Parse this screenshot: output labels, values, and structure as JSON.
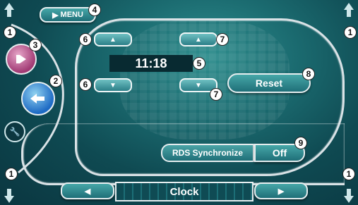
{
  "menu": {
    "label": "MENU"
  },
  "clock": {
    "time": "11:18"
  },
  "buttons": {
    "reset": "Reset",
    "rds_sync": "RDS Synchronize",
    "rds_value": "Off"
  },
  "footer": {
    "title": "Clock"
  },
  "callouts": {
    "c1": "1",
    "c2": "2",
    "c3": "3",
    "c4": "4",
    "c5": "5",
    "c6": "6",
    "c7": "7",
    "c8": "8",
    "c9": "9"
  },
  "icons": {
    "hour_up": "up-arrow-icon",
    "hour_down": "down-arrow-icon",
    "minute_up": "up-arrow-icon",
    "minute_down": "down-arrow-icon",
    "prev": "left-arrow-icon",
    "next": "right-arrow-icon",
    "wrench": "wrench-icon",
    "back": "back-arrow-icon",
    "source": "source-icon"
  },
  "colors": {
    "accent": "#1f6f78",
    "frame": "#d9e2e6"
  }
}
